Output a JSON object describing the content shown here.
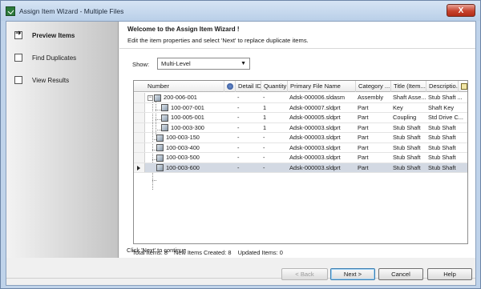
{
  "window": {
    "title": "Assign Item Wizard - Multiple Files",
    "close_glyph": "X"
  },
  "nav": {
    "items": [
      {
        "label": "Preview Items",
        "active": true
      },
      {
        "label": "Find Duplicates",
        "active": false
      },
      {
        "label": "View Results",
        "active": false
      }
    ]
  },
  "header": {
    "welcome": "Welcome to the Assign Item Wizard !",
    "subtitle": "Edit the item properties and select 'Next' to replace duplicate items."
  },
  "show": {
    "label": "Show:",
    "value": "Multi-Level"
  },
  "grid": {
    "columns": [
      "Number",
      "",
      "Detail ID",
      "Quantity",
      "Primary File Name",
      "Category ...",
      "Title (Item...",
      "Descriptio..."
    ],
    "rows": [
      {
        "number": "200-006-001",
        "detail": "-",
        "qty": "-",
        "file": "Adsk-000006.sldasm",
        "category": "Assembly",
        "title": "Shaft Asse...",
        "desc": "Stub Shaft ..."
      },
      {
        "number": "100-007-001",
        "detail": "-",
        "qty": "1",
        "file": "Adsk-000007.sldprt",
        "category": "Part",
        "title": "Key",
        "desc": "Shaft Key"
      },
      {
        "number": "100-005-001",
        "detail": "-",
        "qty": "1",
        "file": "Adsk-000005.sldprt",
        "category": "Part",
        "title": "Coupling",
        "desc": "Std Drive C..."
      },
      {
        "number": "100-003-300",
        "detail": "-",
        "qty": "1",
        "file": "Adsk-000003.sldprt",
        "category": "Part",
        "title": "Stub Shaft",
        "desc": "Stub Shaft"
      },
      {
        "number": "100-003-150",
        "detail": "-",
        "qty": "-",
        "file": "Adsk-000003.sldprt",
        "category": "Part",
        "title": "Stub Shaft",
        "desc": "Stub Shaft"
      },
      {
        "number": "100-003-400",
        "detail": "-",
        "qty": "-",
        "file": "Adsk-000003.sldprt",
        "category": "Part",
        "title": "Stub Shaft",
        "desc": "Stub Shaft"
      },
      {
        "number": "100-003-500",
        "detail": "-",
        "qty": "-",
        "file": "Adsk-000003.sldprt",
        "category": "Part",
        "title": "Stub Shaft",
        "desc": "Stub Shaft"
      },
      {
        "number": "100-003-600",
        "detail": "-",
        "qty": "-",
        "file": "Adsk-000003.sldprt",
        "category": "Part",
        "title": "Stub Shaft",
        "desc": "Stub Shaft"
      }
    ]
  },
  "status": {
    "total": "Total Items: 8",
    "new": "New Items Created: 8",
    "updated": "Updated Items: 0"
  },
  "hint": "Click 'Next' to continue",
  "buttons": {
    "back": "< Back",
    "next": "Next >",
    "cancel": "Cancel",
    "help": "Help"
  }
}
